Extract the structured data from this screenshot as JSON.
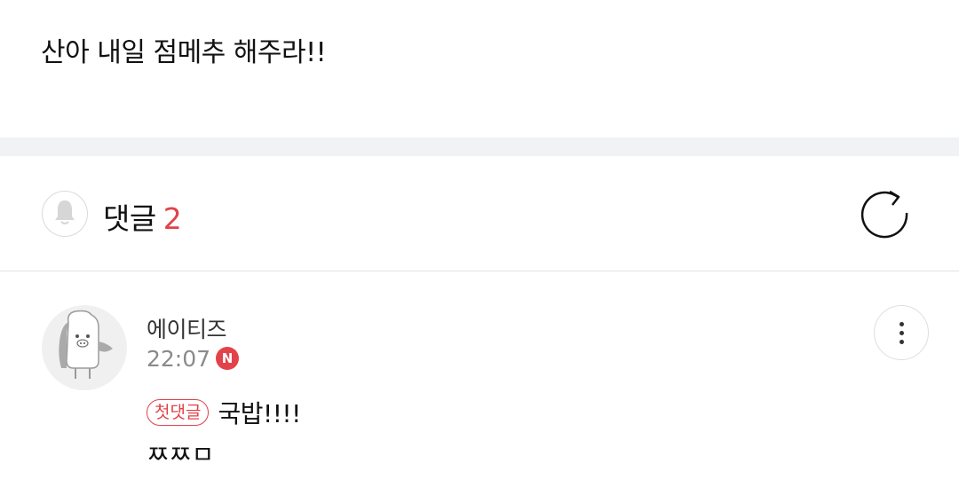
{
  "post": {
    "text": "산아 내일 점메추 해주라!!"
  },
  "comments_header": {
    "title": "댓글",
    "count": "2",
    "icons": {
      "bell": "bell-icon",
      "refresh": "refresh-icon"
    }
  },
  "comment": {
    "author": "에이티즈",
    "time": "22:07",
    "new_badge": "N",
    "first_badge": "첫댓글",
    "line1": "국밥!!!!",
    "line2": "ㅉㅉㅁ",
    "avatar_icon": "character-avatar-icon",
    "more_icon": "more-vertical-icon"
  },
  "colors": {
    "accent": "#e0424b",
    "divider": "#f1f2f6"
  }
}
